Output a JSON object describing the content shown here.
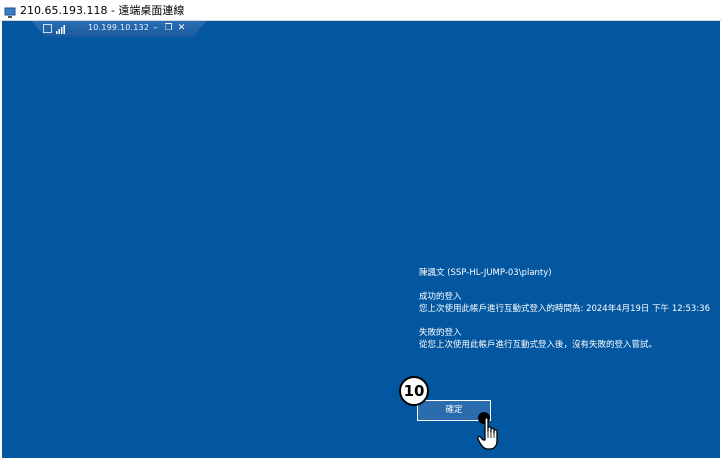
{
  "window": {
    "title": "210.65.193.118 - 遠端桌面連線"
  },
  "connection_bar": {
    "ip": "10.199.10.132",
    "minimize": "–",
    "restore": "❐",
    "close": "✕"
  },
  "login_info": {
    "user": "陳諷文 (SSP-HL-JUMP-03\\planty)",
    "success_heading": "成功的登入",
    "success_detail": "您上次使用此帳戶進行互動式登入的時間為: 2024年4月19日 下午 12:53:36",
    "failure_heading": "失敗的登入",
    "failure_detail": "從您上次使用此帳戶進行互動式登入後，沒有失敗的登入嘗試。"
  },
  "ok_button": {
    "label": "確定"
  },
  "step_marker": {
    "number": "10"
  },
  "colors": {
    "desktop_bg": "#0356a0",
    "button_bg": "#2b6cae"
  }
}
